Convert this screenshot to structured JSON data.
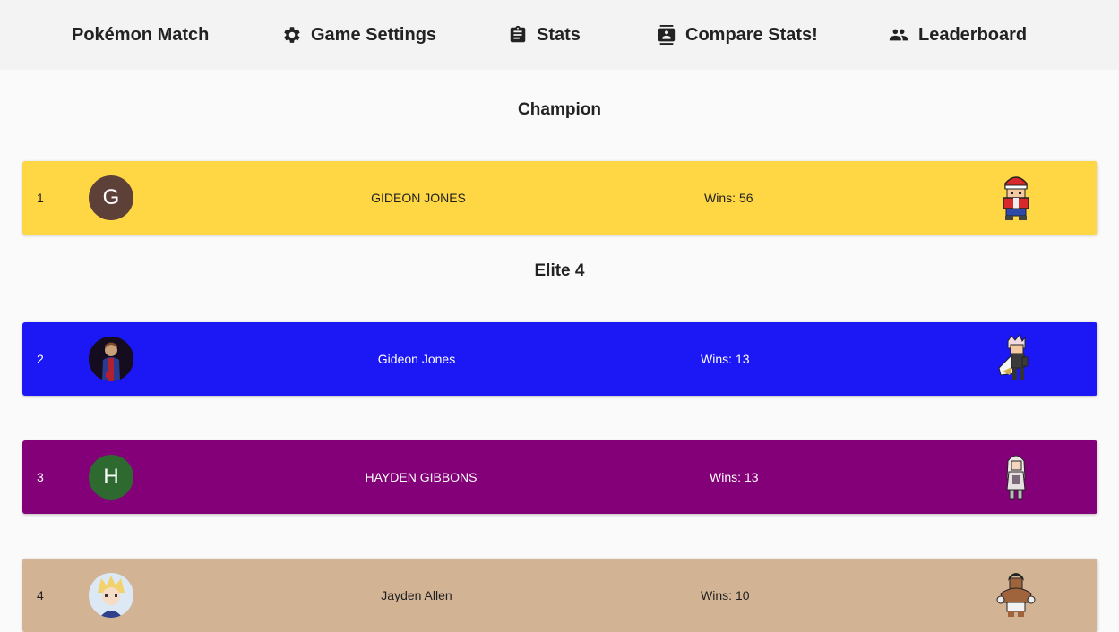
{
  "nav": {
    "brand": "Pokémon Match",
    "settings": "Game Settings",
    "stats": "Stats",
    "compare": "Compare Stats!",
    "leaderboard": "Leaderboard"
  },
  "sections": {
    "champion": "Champion",
    "elite": "Elite 4"
  },
  "wins_label": "Wins:",
  "entries": [
    {
      "rank": "1",
      "name": "GIDEON JONES",
      "wins": "56",
      "avatar_letter": "G",
      "color": "#ffd745",
      "avatar_color": "#5d4037",
      "text_color": "#1f1f1f",
      "sprite": "red-trainer-sprite"
    },
    {
      "rank": "2",
      "name": "Gideon Jones",
      "wins": "13",
      "avatar_letter": "",
      "color": "#1c17f5",
      "avatar_color": "#1a1020",
      "text_color": "#ffffff",
      "sprite": "caped-trainer-sprite"
    },
    {
      "rank": "3",
      "name": "HAYDEN GIBBONS",
      "wins": "13",
      "avatar_letter": "H",
      "color": "#840078",
      "avatar_color": "#2e6a30",
      "text_color": "#ffffff",
      "sprite": "white-haired-trainer-sprite"
    },
    {
      "rank": "4",
      "name": "Jayden Allen",
      "wins": "10",
      "avatar_letter": "",
      "color": "#d2b495",
      "avatar_color": "#a9c9e8",
      "text_color": "#1f1f1f",
      "sprite": "fighter-trainer-sprite"
    }
  ]
}
